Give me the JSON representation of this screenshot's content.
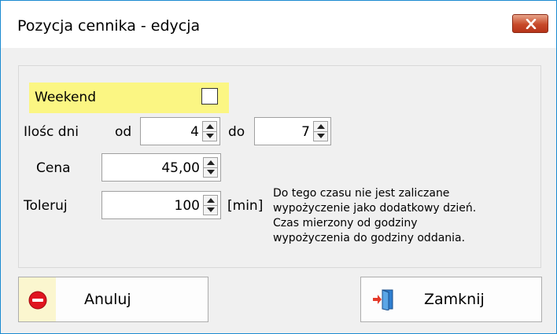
{
  "window": {
    "title": "Pozycja cennika - edycja",
    "close_icon": "close-x-icon",
    "close_color": "#c74a2a"
  },
  "form": {
    "weekend": {
      "label": "Weekend",
      "checked": false,
      "highlight_color": "#fbf683"
    },
    "days": {
      "label": "Ilośc dni",
      "from_label": "od",
      "from_value": "4",
      "to_label": "do",
      "to_value": "7"
    },
    "price": {
      "label": "Cena",
      "value": "45,00"
    },
    "tolerance": {
      "label": "Toleruj",
      "value": "100",
      "unit": "[min]",
      "note": [
        "Do tego czasu nie jest zaliczane",
        "wypożyczenie jako dodatkowy dzień.",
        "Czas mierzony od godziny",
        "wypożyczenia do godziny oddania."
      ]
    }
  },
  "buttons": {
    "cancel": {
      "label": "Anuluj",
      "icon": "stop-icon",
      "icon_color": "#e0151f"
    },
    "close": {
      "label": "Zamknij",
      "icon": "exit-door-icon",
      "icon_color": "#2f7fd0"
    }
  }
}
